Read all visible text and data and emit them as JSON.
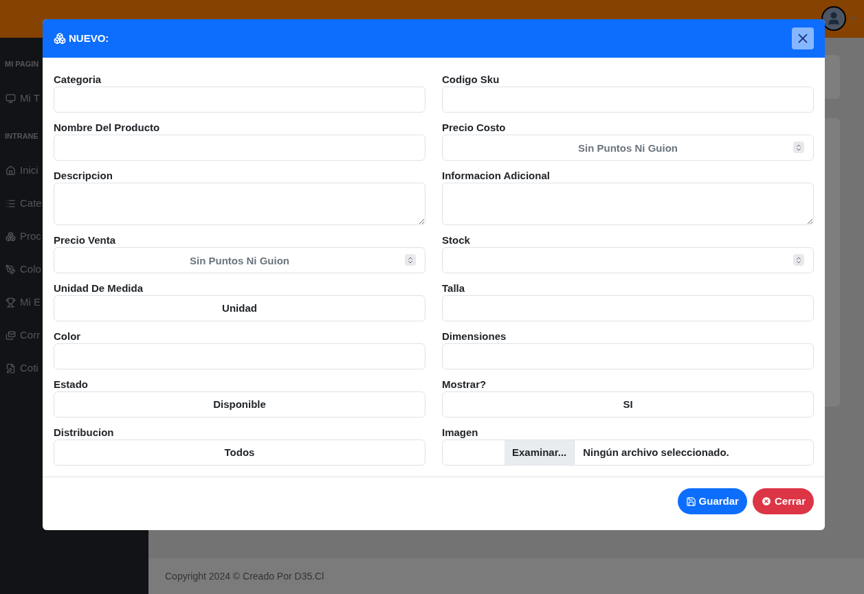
{
  "sidebar": {
    "sections": [
      {
        "title": "MI PAGIN",
        "items": [
          {
            "label": "Mi T"
          }
        ]
      },
      {
        "title": "INTRANE",
        "items": [
          {
            "label": "Inici"
          },
          {
            "label": "Cate"
          },
          {
            "label": "Proc"
          },
          {
            "label": "Colo"
          },
          {
            "label": "Mi E"
          },
          {
            "label": "Corr"
          },
          {
            "label": "Coti"
          }
        ]
      }
    ]
  },
  "footer": {
    "text": "Copyright 2024 © Creado Por D35.Cl"
  },
  "modal": {
    "title": "NUEVO:",
    "fields": [
      {
        "label": "Categoria",
        "kind": "text"
      },
      {
        "label": "Codigo Sku",
        "kind": "text"
      },
      {
        "label": "Nombre Del Producto",
        "kind": "text"
      },
      {
        "label": "Precio Costo",
        "kind": "number",
        "placeholder": "Sin Puntos Ni Guion"
      },
      {
        "label": "Descripcion",
        "kind": "textarea"
      },
      {
        "label": "Informacion Adicional",
        "kind": "textarea"
      },
      {
        "label": "Precio Venta",
        "kind": "number",
        "placeholder": "Sin Puntos Ni Guion"
      },
      {
        "label": "Stock",
        "kind": "number"
      },
      {
        "label": "Unidad De Medida",
        "kind": "select",
        "value": "Unidad"
      },
      {
        "label": "Talla",
        "kind": "text"
      },
      {
        "label": "Color",
        "kind": "text"
      },
      {
        "label": "Dimensiones",
        "kind": "text"
      },
      {
        "label": "Estado",
        "kind": "select",
        "value": "Disponible"
      },
      {
        "label": "Mostrar?",
        "kind": "select",
        "value": "SI"
      },
      {
        "label": "Distribucion",
        "kind": "select",
        "value": "Todos"
      },
      {
        "label": "Imagen",
        "kind": "file",
        "button": "Examinar...",
        "value": "Ningún archivo seleccionado."
      }
    ],
    "buttons": [
      {
        "label": "Guardar",
        "kind": "primary"
      },
      {
        "label": "Cerrar",
        "kind": "danger"
      }
    ]
  }
}
